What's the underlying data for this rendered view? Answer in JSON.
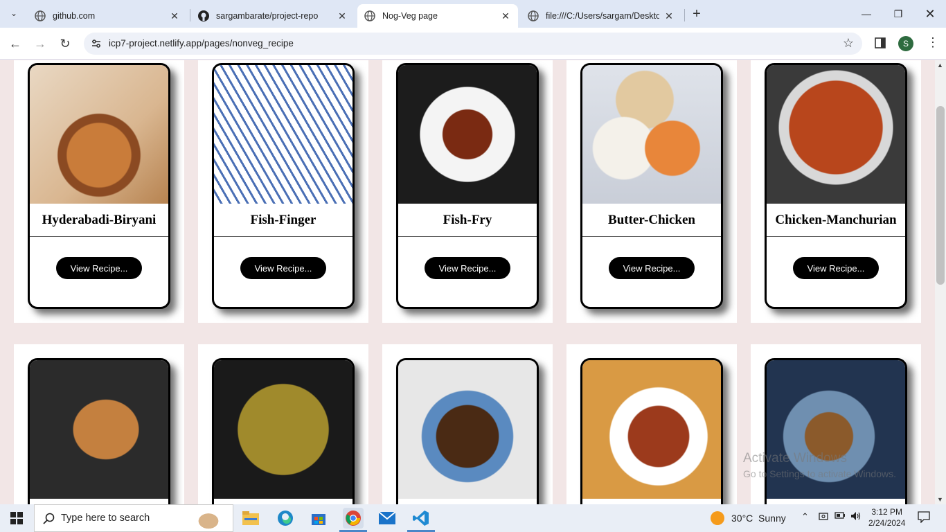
{
  "tabs": [
    {
      "title": "github.com",
      "icon": "globe-icon"
    },
    {
      "title": "sargambarate/project-repo",
      "icon": "github-icon"
    },
    {
      "title": "Nog-Veg page",
      "icon": "globe-icon",
      "active": true
    },
    {
      "title": "file:///C:/Users/sargam/Desktop",
      "icon": "globe-icon"
    }
  ],
  "address_bar": {
    "url": "icp7-project.netlify.app/pages/nonveg_recipe"
  },
  "profile_initial": "S",
  "recipes": [
    {
      "name": "Hyderabadi-Biryani",
      "button": "View Recipe..."
    },
    {
      "name": "Fish-Finger",
      "button": "View Recipe..."
    },
    {
      "name": "Fish-Fry",
      "button": "View Recipe..."
    },
    {
      "name": "Butter-Chicken",
      "button": "View Recipe..."
    },
    {
      "name": "Chicken-Manchurian",
      "button": "View Recipe..."
    }
  ],
  "recipes_row2_images": [
    "pomfret-fish",
    "green-fish-curry",
    "egg-curry",
    "chicken-fry",
    "kebabs"
  ],
  "watermark": {
    "line1": "Activate Windows",
    "line2": "Go to Settings to activate Windows."
  },
  "taskbar": {
    "search_placeholder": "Type here to search",
    "weather": "30°C  Sunny",
    "time": "3:12 PM",
    "date": "2/24/2024"
  }
}
